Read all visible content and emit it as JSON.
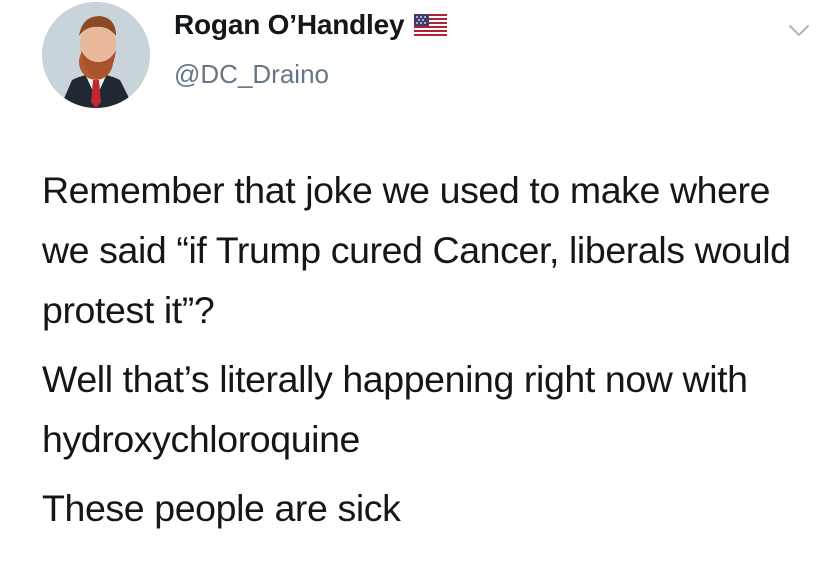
{
  "user": {
    "display_name": "Rogan O’Handley",
    "handle": "@DC_Draino",
    "flag_icon": "us-flag-icon",
    "avatar_icon": "avatar-icon"
  },
  "header": {
    "menu_icon": "chevron-down-icon"
  },
  "tweet": {
    "paragraphs": [
      "Remember that joke we used to make where we said “if Trump cured Cancer, liberals would protest it”?",
      "Well that’s literally happening right now with hydroxychloroquine",
      "These people are sick"
    ]
  },
  "colors": {
    "text": "#14171a",
    "secondary": "#657786",
    "chevron": "#aab8c2"
  }
}
